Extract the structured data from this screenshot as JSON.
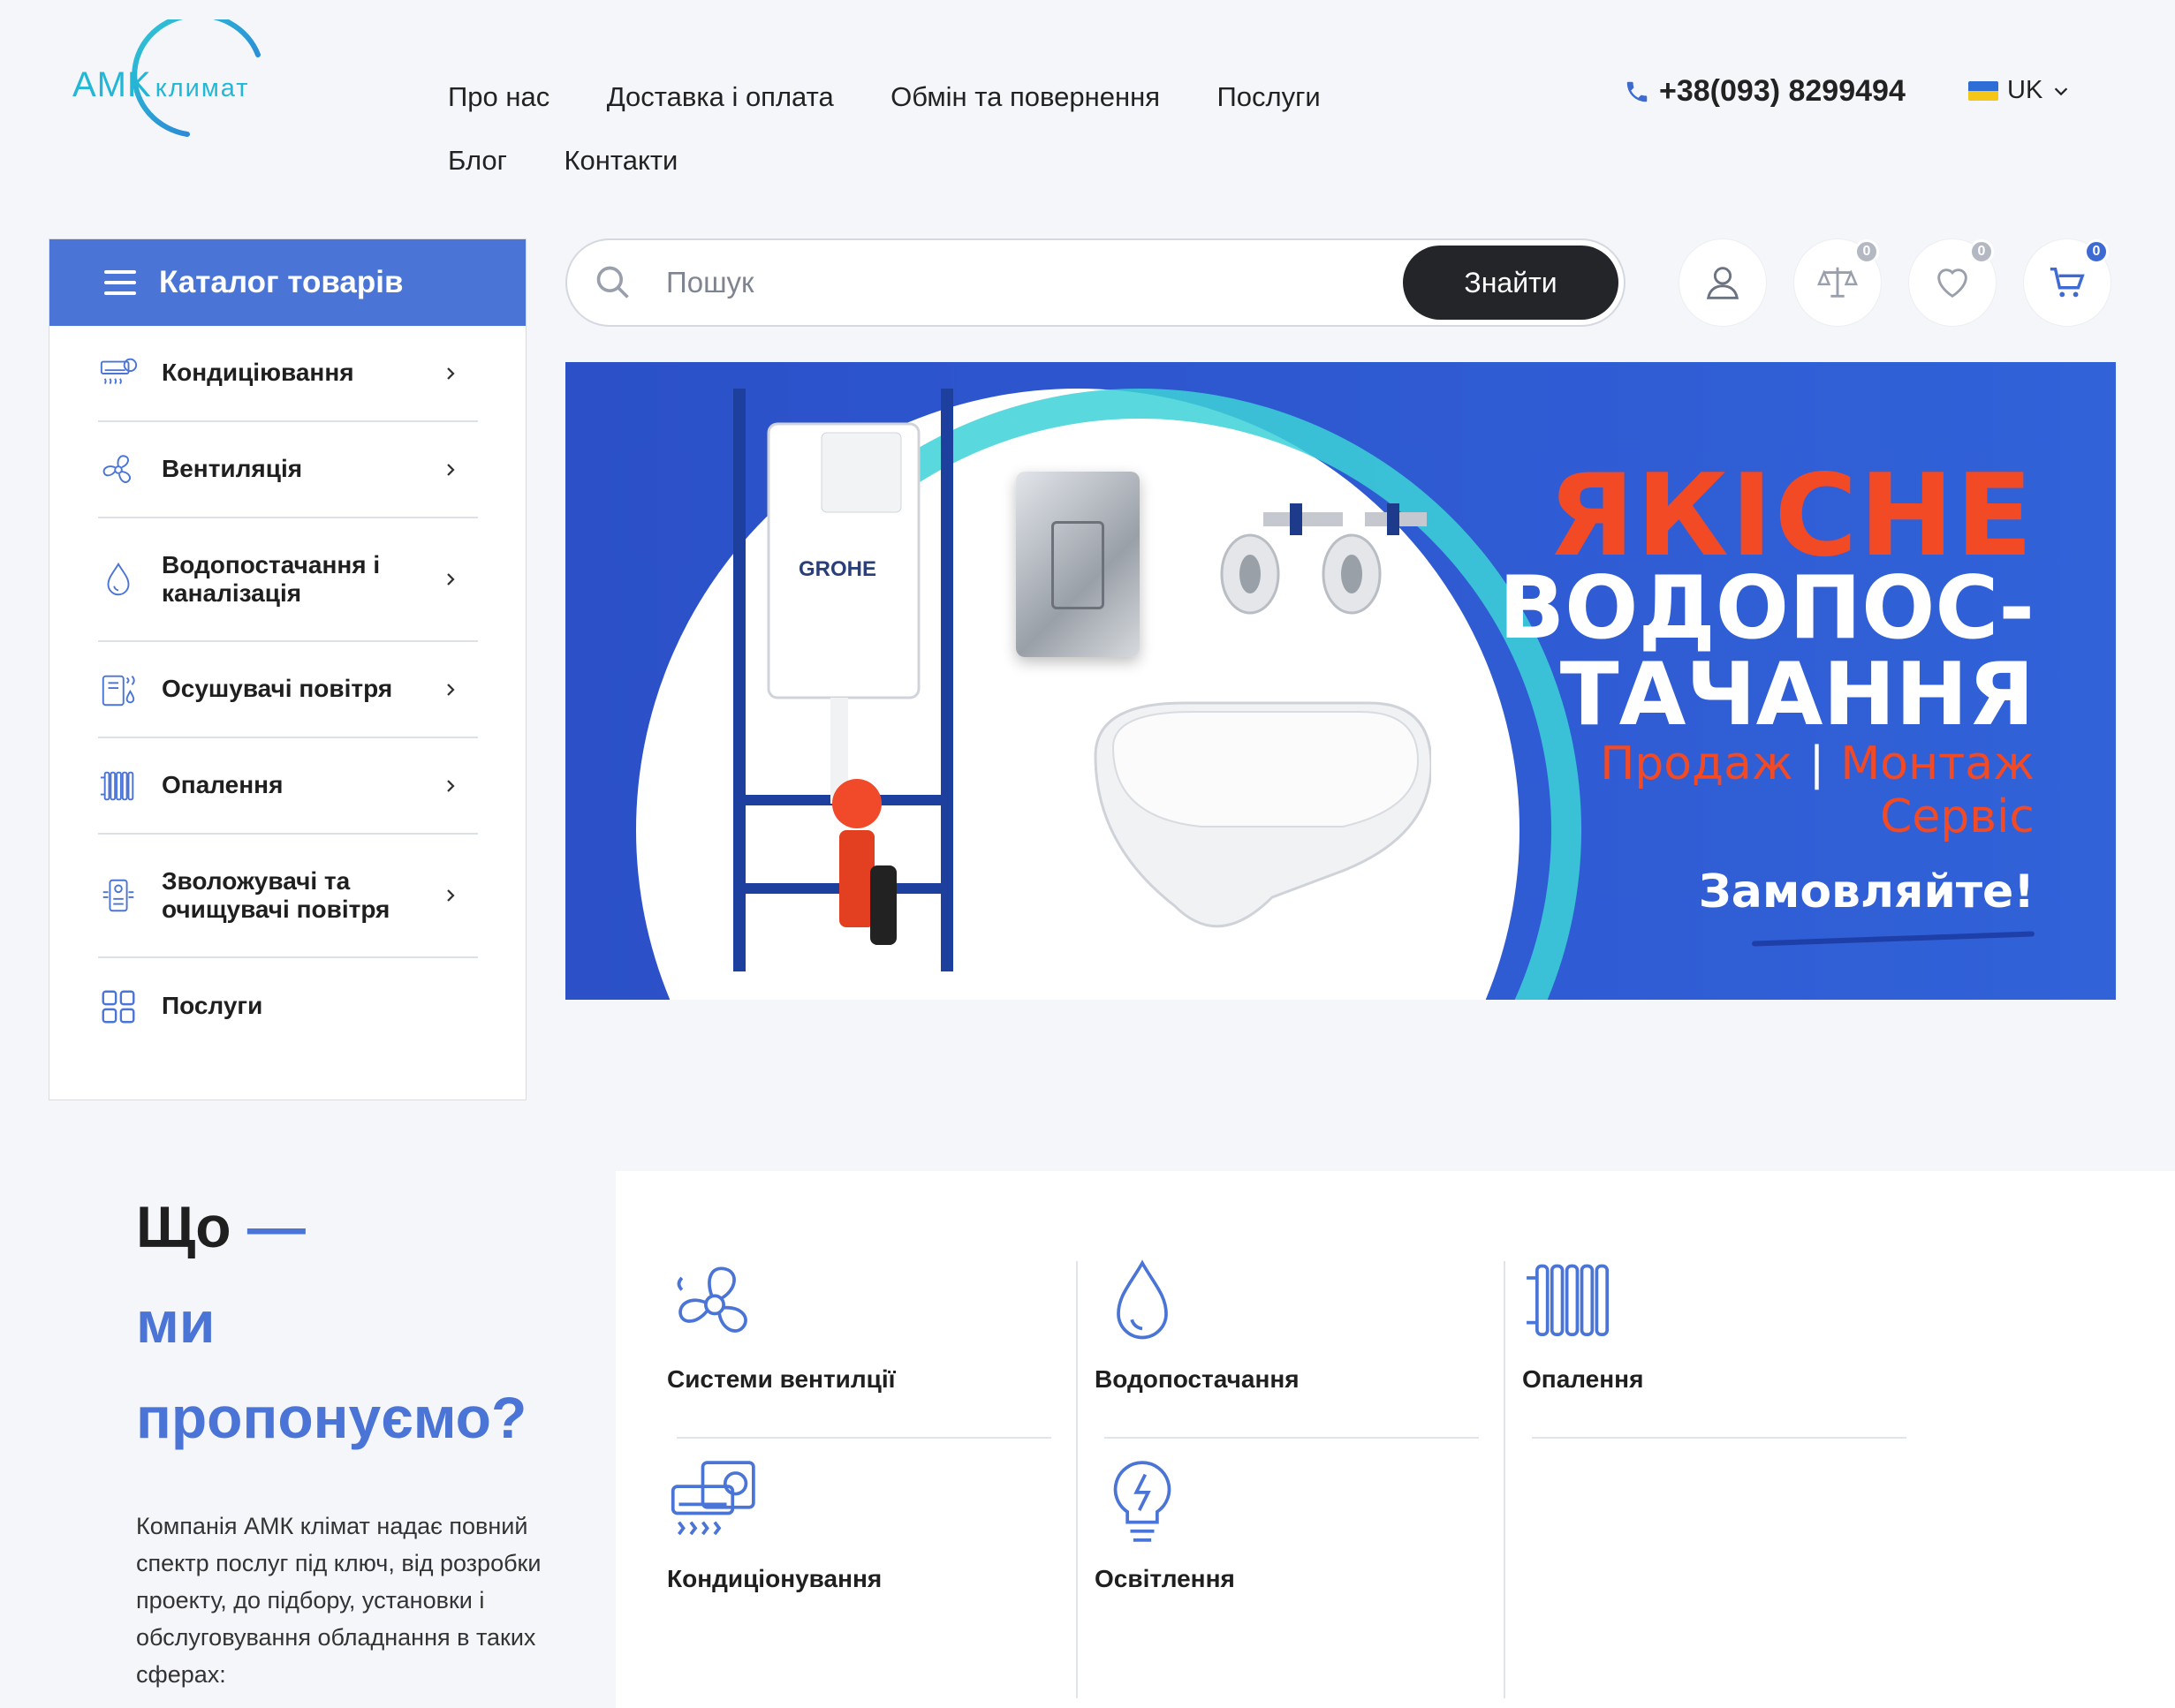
{
  "header": {
    "logo_main": "AMK",
    "logo_sub": "климат",
    "nav": [
      "Про нас",
      "Доставка і оплата",
      "Обмін та повернення",
      "Послуги",
      "Блог",
      "Контакти"
    ],
    "phone": "+38(093) 8299494",
    "lang": "UK"
  },
  "catalog": {
    "title": "Каталог товарів",
    "items": [
      {
        "label": "Кондиціювання",
        "icon": "air-conditioner-icon"
      },
      {
        "label": "Вентиляція",
        "icon": "fan-icon"
      },
      {
        "label": "Водопостачання і каналізація",
        "icon": "water-drop-icon"
      },
      {
        "label": "Осушувачі повітря",
        "icon": "dehumidifier-icon"
      },
      {
        "label": "Опалення",
        "icon": "radiator-icon"
      },
      {
        "label": "Зволожувачі та очищувачі повітря",
        "icon": "humidifier-icon"
      },
      {
        "label": "Послуги",
        "icon": "grid-icon"
      }
    ]
  },
  "search": {
    "placeholder": "Пошук",
    "button": "Знайти"
  },
  "toolbar": {
    "compare_count": "0",
    "wishlist_count": "0",
    "cart_count": "0"
  },
  "banner": {
    "title1": "ЯКІСНЕ",
    "title2_line1": "ВОДОПОС-",
    "title2_line2": "ТАЧАННЯ",
    "sub1": "Продаж",
    "sub_sep": "|",
    "sub2": "Монтаж",
    "sub3": "Сервіс",
    "cta": "Замовляйте!",
    "brand": "GROHE",
    "slides": 3,
    "active_slide": 1
  },
  "offers": {
    "heading_line1": "Що",
    "heading_dash": "—",
    "heading_line2": "ми",
    "heading_line3": "пропонуємо?",
    "text": "Компанія АМК клімат надає повний спектр послуг під ключ, від розробки проекту, до підбору, установки і обслуговування обладнання в таких сферах:",
    "services": [
      {
        "label": "Системи вентилції",
        "icon": "fan-icon"
      },
      {
        "label": "Водопостачання",
        "icon": "water-drop-icon"
      },
      {
        "label": "Опалення",
        "icon": "radiator-icon"
      },
      {
        "label": "Кондиціонування",
        "icon": "air-conditioner-icon"
      },
      {
        "label": "Освітлення",
        "icon": "lightbulb-icon"
      }
    ]
  },
  "colors": {
    "accent": "#4a74d6",
    "banner_bg": "#2f5bd3",
    "banner_red": "#f24a25",
    "logo_teal": "#23b7d6",
    "button_dark": "#232528"
  }
}
